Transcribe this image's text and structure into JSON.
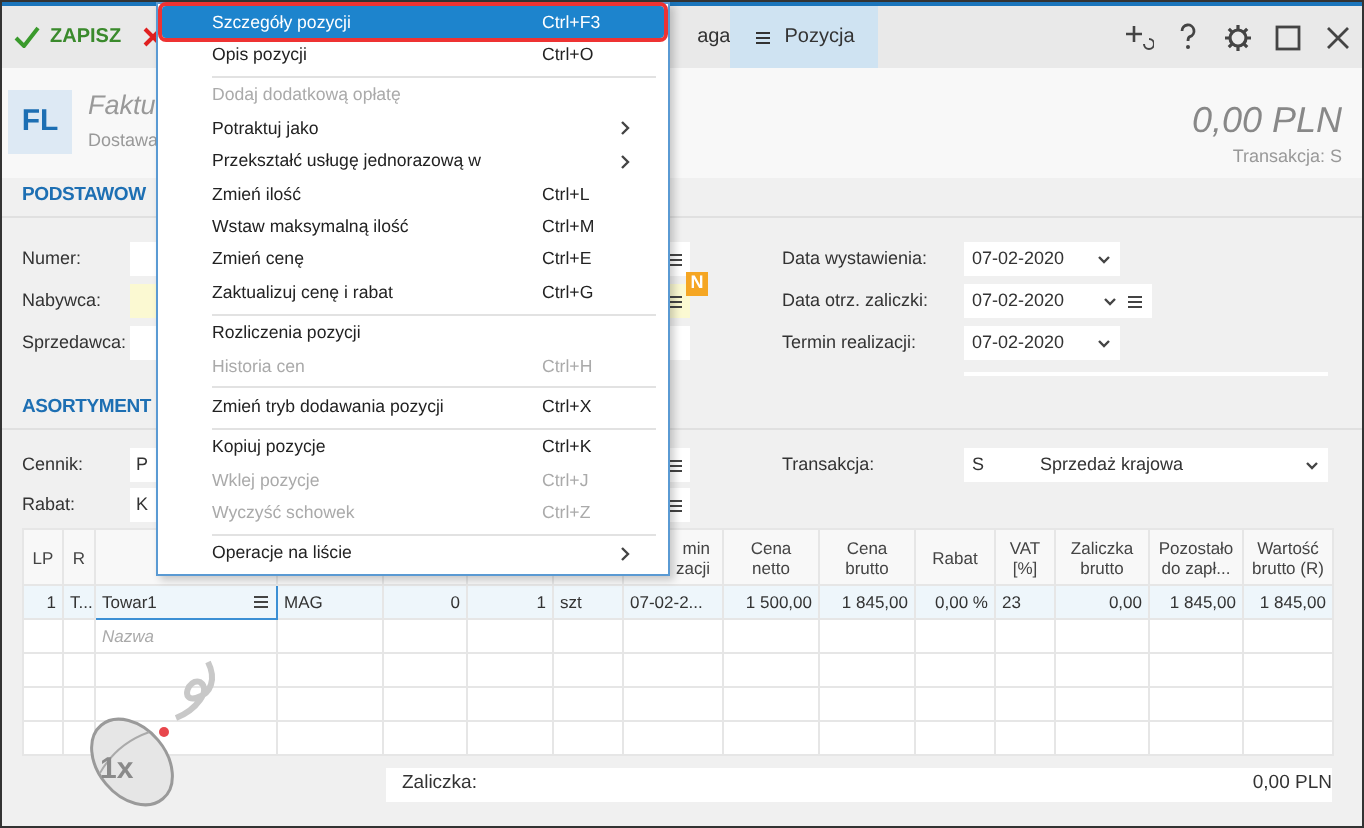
{
  "toolbar": {
    "save": "ZAPISZ",
    "cut_tab": "aga",
    "tab": {
      "label": "Pozycja",
      "selected": true
    }
  },
  "document": {
    "badge": "FL",
    "title": "Faktu",
    "subtitle": "Dostawa",
    "total": "0,00 PLN",
    "transaction": "Transakcja: S"
  },
  "basic": {
    "heading": "PODSTAWOW",
    "labels": [
      "Numer:",
      "Nabywca:",
      "Sprzedawca:"
    ],
    "new_badge": "N",
    "dates": [
      {
        "label": "Data wystawienia:",
        "value": "07-02-2020",
        "list_button": false
      },
      {
        "label": "Data otrz. zaliczki:",
        "value": "07-02-2020",
        "list_button": true
      },
      {
        "label": "Termin realizacji:",
        "value": "07-02-2020",
        "list_button": false
      }
    ]
  },
  "assortment": {
    "heading": "ASORTYMENT",
    "labels": [
      "Cennik:",
      "Rabat:"
    ],
    "values": [
      "P",
      "K"
    ],
    "transaction": {
      "label": "Transakcja:",
      "code": "S",
      "value": "Sprzedaż krajowa"
    }
  },
  "table": {
    "columns": [
      "LP",
      "R",
      "",
      "",
      "",
      "",
      "",
      "min zacji",
      "Cena netto",
      "Cena brutto",
      "Rabat",
      "VAT [%]",
      "Zaliczka brutto",
      "Pozostało do zapł...",
      "Wartość brutto (R)"
    ],
    "rows": [
      [
        "1",
        "T...",
        "Towar1",
        "MAG",
        "0",
        "1",
        "szt",
        "07-02-2...",
        "1 500,00",
        "1 845,00",
        "0,00 %",
        "23",
        "0,00",
        "1 845,00",
        "1 845,00"
      ]
    ],
    "placeholder": "Nazwa"
  },
  "footer": {
    "label": "Zaliczka:",
    "value": "0,00 PLN"
  },
  "hint": {
    "label": "1x"
  },
  "menu": [
    {
      "kind": "item",
      "label": "Szczegóły pozycji",
      "shortcut": "Ctrl+F3",
      "selected": true,
      "disabled": false,
      "submenu": false
    },
    {
      "kind": "item",
      "label": "Opis pozycji",
      "shortcut": "Ctrl+O",
      "selected": false,
      "disabled": false,
      "submenu": false
    },
    {
      "kind": "separator"
    },
    {
      "kind": "item",
      "label": "Dodaj dodatkową opłatę",
      "selected": false,
      "disabled": true,
      "submenu": false
    },
    {
      "kind": "item",
      "label": "Potraktuj jako",
      "selected": false,
      "disabled": false,
      "submenu": true
    },
    {
      "kind": "item",
      "label": "Przekształć usługę jednorazową w",
      "selected": false,
      "disabled": false,
      "submenu": true
    },
    {
      "kind": "item",
      "label": "Zmień ilość",
      "shortcut": "Ctrl+L",
      "selected": false,
      "disabled": false,
      "submenu": false
    },
    {
      "kind": "item",
      "label": "Wstaw maksymalną ilość",
      "shortcut": "Ctrl+M",
      "selected": false,
      "disabled": false,
      "submenu": false
    },
    {
      "kind": "item",
      "label": "Zmień cenę",
      "shortcut": "Ctrl+E",
      "selected": false,
      "disabled": false,
      "submenu": false
    },
    {
      "kind": "item",
      "label": "Zaktualizuj cenę i rabat",
      "shortcut": "Ctrl+G",
      "selected": false,
      "disabled": false,
      "submenu": false
    },
    {
      "kind": "separator"
    },
    {
      "kind": "item",
      "label": "Rozliczenia pozycji",
      "selected": false,
      "disabled": false,
      "submenu": false
    },
    {
      "kind": "item",
      "label": "Historia cen",
      "shortcut": "Ctrl+H",
      "selected": false,
      "disabled": true,
      "submenu": false
    },
    {
      "kind": "separator"
    },
    {
      "kind": "item",
      "label": "Zmień tryb dodawania pozycji",
      "shortcut": "Ctrl+X",
      "selected": false,
      "disabled": false,
      "submenu": false
    },
    {
      "kind": "separator"
    },
    {
      "kind": "item",
      "label": "Kopiuj pozycje",
      "shortcut": "Ctrl+K",
      "selected": false,
      "disabled": false,
      "submenu": false
    },
    {
      "kind": "item",
      "label": "Wklej pozycje",
      "shortcut": "Ctrl+J",
      "selected": false,
      "disabled": true,
      "submenu": false
    },
    {
      "kind": "item",
      "label": "Wyczyść schowek",
      "shortcut": "Ctrl+Z",
      "selected": false,
      "disabled": true,
      "submenu": false
    },
    {
      "kind": "separator"
    },
    {
      "kind": "item",
      "label": "Operacje na liście",
      "selected": false,
      "disabled": false,
      "submenu": true
    }
  ]
}
